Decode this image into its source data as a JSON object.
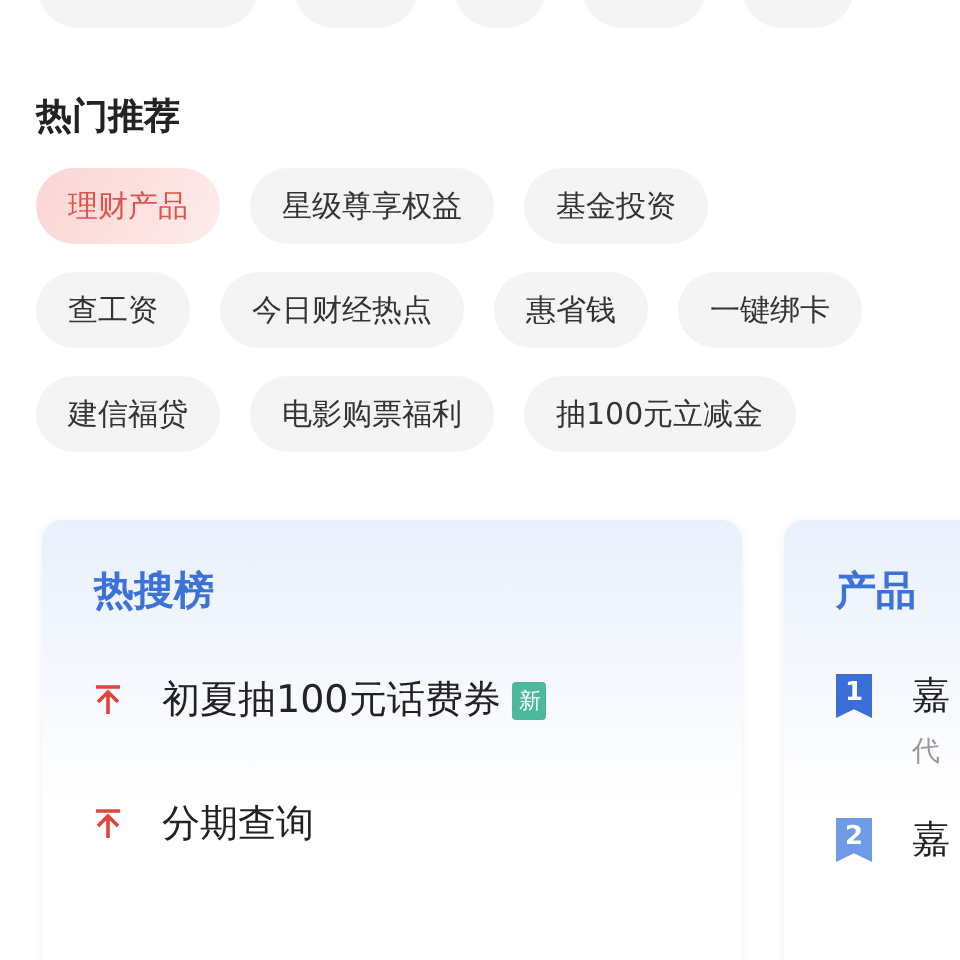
{
  "hot_recommend": {
    "title": "热门推荐",
    "chips": [
      [
        {
          "label": "理财产品",
          "selected": true
        },
        {
          "label": "星级尊享权益",
          "selected": false
        },
        {
          "label": "基金投资",
          "selected": false
        }
      ],
      [
        {
          "label": "查工资",
          "selected": false
        },
        {
          "label": "今日财经热点",
          "selected": false
        },
        {
          "label": "惠省钱",
          "selected": false
        },
        {
          "label": "一键绑卡",
          "selected": false
        }
      ],
      [
        {
          "label": "建信福贷",
          "selected": false
        },
        {
          "label": "电影购票福利",
          "selected": false
        },
        {
          "label": "抽100元立减金",
          "selected": false
        }
      ]
    ]
  },
  "hot_search": {
    "title": "热搜榜",
    "items": [
      {
        "label": "初夏抽100元话费券",
        "badge": "新"
      },
      {
        "label": "分期查询"
      }
    ]
  },
  "product_ranking": {
    "title": "产品",
    "items": [
      {
        "rank": "1",
        "name": "嘉",
        "subtitle": "代"
      },
      {
        "rank": "2",
        "name": "嘉"
      }
    ]
  }
}
